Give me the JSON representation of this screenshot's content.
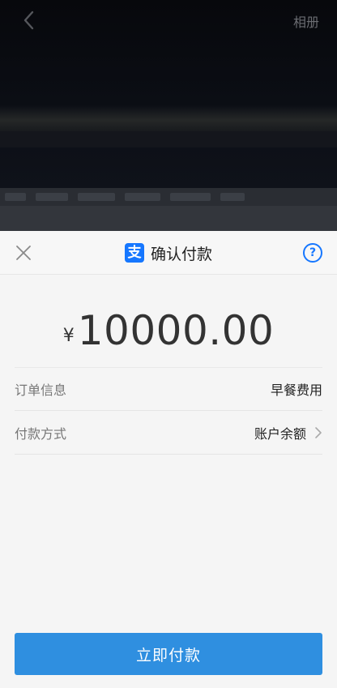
{
  "topbar": {
    "album_label": "相册"
  },
  "sheet": {
    "title": "确认付款",
    "logo_char": "支",
    "help_char": "?",
    "currency": "¥",
    "amount": "10000.00",
    "order": {
      "label": "订单信息",
      "value": "早餐费用"
    },
    "method": {
      "label": "付款方式",
      "value": "账户余额"
    },
    "pay_button": "立即付款"
  },
  "colors": {
    "accent": "#1677ff",
    "button": "#2f8fe0",
    "sheet_bg": "#f5f5f5"
  },
  "icons": [
    "back-icon",
    "close-icon",
    "alipay-logo-icon",
    "help-icon",
    "chevron-right-icon"
  ]
}
